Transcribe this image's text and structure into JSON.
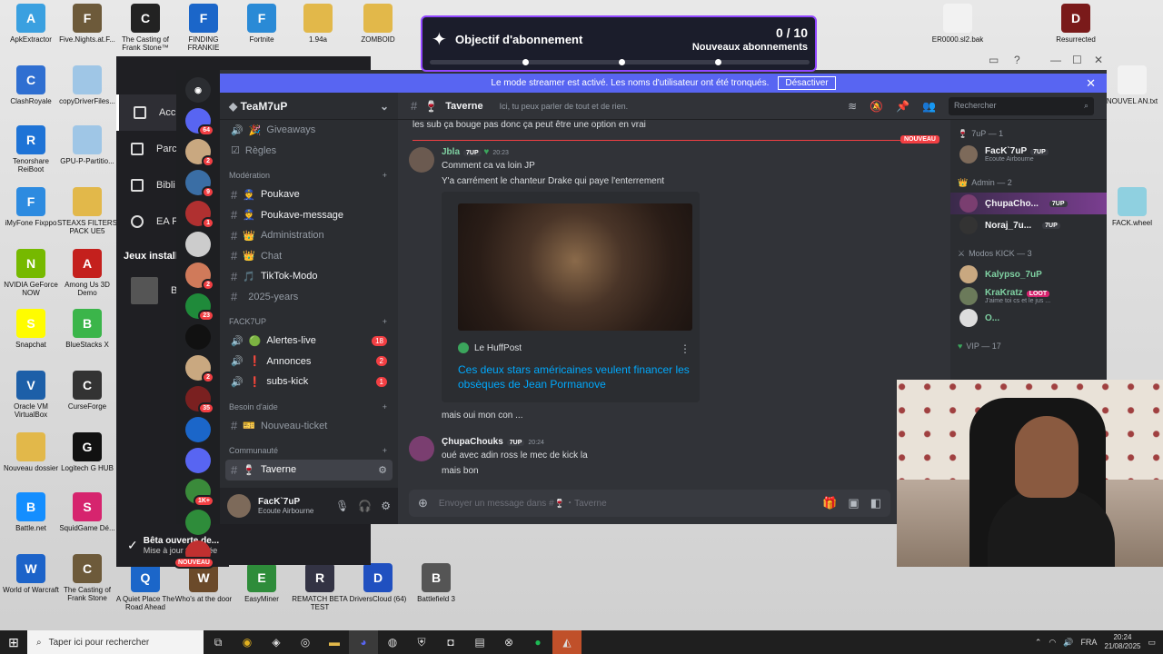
{
  "desktop_icons": [
    {
      "label": "ApkExtractor",
      "color": "#3aa0e0",
      "glyph": "A"
    },
    {
      "label": "Five.Nights.at.F...",
      "color": "#6d5a3a",
      "glyph": "F"
    },
    {
      "label": "The Casting of Frank Stone™",
      "color": "#222",
      "glyph": "C"
    },
    {
      "label": "FINDING FRANKIE",
      "color": "#1b66c9",
      "glyph": "F"
    },
    {
      "label": "Fortnite",
      "color": "#2a8ad6",
      "glyph": "F"
    },
    {
      "label": "1.94a",
      "color": "#e2b84a",
      "glyph": ""
    },
    {
      "label": "ZOMBOID",
      "color": "#e2b84a",
      "glyph": ""
    },
    {
      "label": "ER0000.sl2.bak",
      "color": "#f2f2f2",
      "glyph": ""
    },
    {
      "label": "Resurrected",
      "color": "#7a1a1a",
      "glyph": "D"
    },
    {
      "label": "ClashRoyale",
      "color": "#2f6fd1",
      "glyph": "C"
    },
    {
      "label": "copyDriverFiles...",
      "color": "#9fc6e6",
      "glyph": ""
    },
    {
      "label": "NOUVEL AN.txt",
      "color": "#f2f2f2",
      "glyph": ""
    },
    {
      "label": "Tenorshare ReiBoot",
      "color": "#1e73d6",
      "glyph": "R"
    },
    {
      "label": "GPU-P-Partitio...",
      "color": "#9fc6e6",
      "glyph": ""
    },
    {
      "label": "iMyFone Fixppo",
      "color": "#2d8be0",
      "glyph": "F"
    },
    {
      "label": "STEAXS FILTERS PACK UE5",
      "color": "#e2b84a",
      "glyph": ""
    },
    {
      "label": "FACK.wheel",
      "color": "#8fd0e0",
      "glyph": ""
    },
    {
      "label": "NVIDIA GeForce NOW",
      "color": "#76b900",
      "glyph": "N"
    },
    {
      "label": "Among Us 3D Demo",
      "color": "#c4201d",
      "glyph": "A"
    },
    {
      "label": "Snapchat",
      "color": "#fffc00",
      "glyph": "S"
    },
    {
      "label": "BlueStacks X",
      "color": "#3bb54a",
      "glyph": "B"
    },
    {
      "label": "Oracle VM VirtualBox",
      "color": "#1d5fa8",
      "glyph": "V"
    },
    {
      "label": "CurseForge",
      "color": "#333",
      "glyph": "C"
    },
    {
      "label": "Nouveau dossier",
      "color": "#e2b84a",
      "glyph": ""
    },
    {
      "label": "Logitech G HUB",
      "color": "#111",
      "glyph": "G"
    },
    {
      "label": "Battle.net",
      "color": "#148eff",
      "glyph": "B"
    },
    {
      "label": "SquidGame Dé...",
      "color": "#d6246e",
      "glyph": "S"
    },
    {
      "label": "World of Warcraft",
      "color": "#1c63c9",
      "glyph": "W"
    },
    {
      "label": "The Casting of Frank Stone",
      "color": "#6d5a3a",
      "glyph": "C"
    },
    {
      "label": "A Quiet Place The Road Ahead",
      "color": "#1b66c9",
      "glyph": "Q"
    },
    {
      "label": "Who's at the door",
      "color": "#6b4a2a",
      "glyph": "W"
    },
    {
      "label": "EasyMiner",
      "color": "#2e8c3a",
      "glyph": "E"
    },
    {
      "label": "REMATCH BETA TEST",
      "color": "#334",
      "glyph": "R"
    },
    {
      "label": "DriversCloud (64)",
      "color": "#2050c0",
      "glyph": "D"
    },
    {
      "label": "Battlefield 3",
      "color": "#555",
      "glyph": "B"
    }
  ],
  "ea_app": {
    "items": [
      "Accu",
      "Parc",
      "Bibli",
      "EA F"
    ],
    "section": "Jeux installé",
    "game": "Batt",
    "toast_title": "Bêta ouverte de...",
    "toast_sub": "Mise à jour terminée"
  },
  "goal": {
    "title": "Objectif d'abonnement",
    "count": "0 / 10",
    "subtitle": "Nouveaux abonnements",
    "progress": 0.0
  },
  "discord": {
    "streamer_banner": "Le mode streamer est activé. Les noms d'utilisateur ont été tronqués.",
    "streamer_button": "Désactiver",
    "server_name": "TeaM7uP",
    "guild_badges": [
      "64",
      "2",
      "9",
      "1",
      "",
      "2",
      "23",
      "",
      "2",
      "35",
      "",
      "",
      "1K+",
      "",
      "NOUVEAU"
    ],
    "channels": [
      {
        "name": "Giveaways",
        "emoji": "🎉",
        "type": "voice",
        "bold": false
      },
      {
        "name": "Règles",
        "emoji": "",
        "type": "text",
        "bold": false
      }
    ],
    "cat_moderation": "Modération",
    "mod_channels": [
      {
        "name": "Poukave",
        "emoji": "👮",
        "bold": true
      },
      {
        "name": "Poukave-message",
        "emoji": "👮",
        "bold": true
      },
      {
        "name": "Administration",
        "emoji": "👑",
        "bold": false
      },
      {
        "name": "Chat",
        "emoji": "👑",
        "bold": false
      },
      {
        "name": "TikTok-Modo",
        "emoji": "🎵",
        "bold": true
      },
      {
        "name": "2025-years",
        "emoji": "",
        "bold": false
      }
    ],
    "cat_fack": "FACK7UP",
    "fack_channels": [
      {
        "name": "Alertes-live",
        "emoji": "🟢",
        "badge": "18"
      },
      {
        "name": "Annonces",
        "emoji": "❗",
        "badge": "2"
      },
      {
        "name": "subs-kick",
        "emoji": "❗",
        "badge": "1"
      }
    ],
    "cat_help": "Besoin d'aide",
    "help_channel": "Nouveau-ticket",
    "cat_community": "Communauté",
    "active_channel": "Taverne",
    "user": {
      "name": "FacK`7uP",
      "status": "Ecoute Airbourne"
    },
    "header": {
      "channel": "Taverne",
      "topic": "Ici, tu peux parler de tout et de rien.",
      "search": "Rechercher"
    },
    "messages": {
      "prev_text": "les sub ça bouge pas donc ça peut être une option en vrai",
      "new_label": "NOUVEAU",
      "m1_author": "Jbla",
      "m1_tag": "7UP",
      "m1_time": "20:23",
      "m1_line1": "Comment ca va loin JP",
      "m1_line2": "Y'a carrément le chanteur Drake qui paye l'enterrement",
      "embed_source": "Le HuffPost",
      "embed_title": "Ces deux stars américaines veulent financer les obsèques de Jean Pormanove",
      "m1_line3": "mais oui mon con ...",
      "m2_author": "ÇhupaChouks",
      "m2_tag": "7UP",
      "m2_time": "20:24",
      "m2_line1": "oué avec adin ross le mec de kick la",
      "m2_line2": "mais bon"
    },
    "composer_placeholder": "Envoyer un message dans #🍷・Taverne",
    "members": {
      "cat1": "7uP — 1",
      "m1_name": "FacK`7uP",
      "m1_tag": "7UP",
      "m1_sub": "Ecoute Airbourne",
      "cat2": "Admin — 2",
      "m2_name": "ÇhupaCho...",
      "m2_tag": "7UP",
      "m3_name": "Noraj_7u...",
      "m3_tag": "7UP",
      "cat3": "Modos KICK — 3",
      "m4_name": "Kalypso_7uP",
      "m5_name": "KraKratz",
      "m5_tag": "LOOT",
      "m5_sub": "J'aime toi cs et le jus ...",
      "m6_name": "O...",
      "cat4": "VIP — 17"
    }
  },
  "taskbar": {
    "search": "Taper ici pour rechercher",
    "lang": "FRA",
    "time": "20:24",
    "date": "21/08/2025"
  }
}
